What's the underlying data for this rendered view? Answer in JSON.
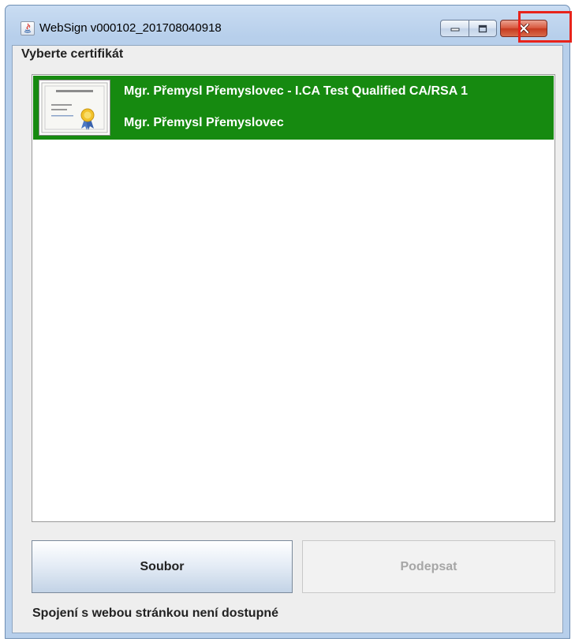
{
  "window": {
    "title": "WebSign v000102_201708040918"
  },
  "main": {
    "section_label": "Vyberte certifikát",
    "certificates": [
      {
        "title": "Mgr. Přemysl Přemyslovec - I.CA Test Qualified CA/RSA 1",
        "subtitle": "Mgr. Přemysl Přemyslovec",
        "selected": true
      }
    ],
    "buttons": {
      "file_label": "Soubor",
      "sign_label": "Podepsat"
    },
    "status_text": "Spojení s webou stránkou není dostupné"
  },
  "icons": {
    "app": "java-icon",
    "certificate": "certificate-icon",
    "minimize": "minimize-icon",
    "maximize": "maximize-icon",
    "close": "close-icon"
  },
  "colors": {
    "selection": "#168a10",
    "highlight": "#e8231b",
    "close_button": "#c63a1f"
  }
}
